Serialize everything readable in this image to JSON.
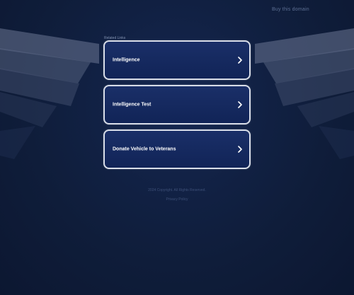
{
  "header": {
    "top_link": "Buy this domain"
  },
  "main": {
    "section_label": "Related Links",
    "links": [
      {
        "label": "Intelligence",
        "icon": "chevron-right-icon"
      },
      {
        "label": "Intelligence Test",
        "icon": "chevron-right-icon"
      },
      {
        "label": "Donate Vehicle to Veterans",
        "icon": "chevron-right-icon"
      }
    ]
  },
  "footer": {
    "copyright": "2024 Copyright. All Rights Reserved.",
    "privacy": "Privacy Policy"
  },
  "colors": {
    "background": "#0f1d3a",
    "button_fill": "#142a60",
    "button_border": "#d8dde8",
    "wing_light": "#6a7a98",
    "wing_dark": "#2a3a5c"
  }
}
